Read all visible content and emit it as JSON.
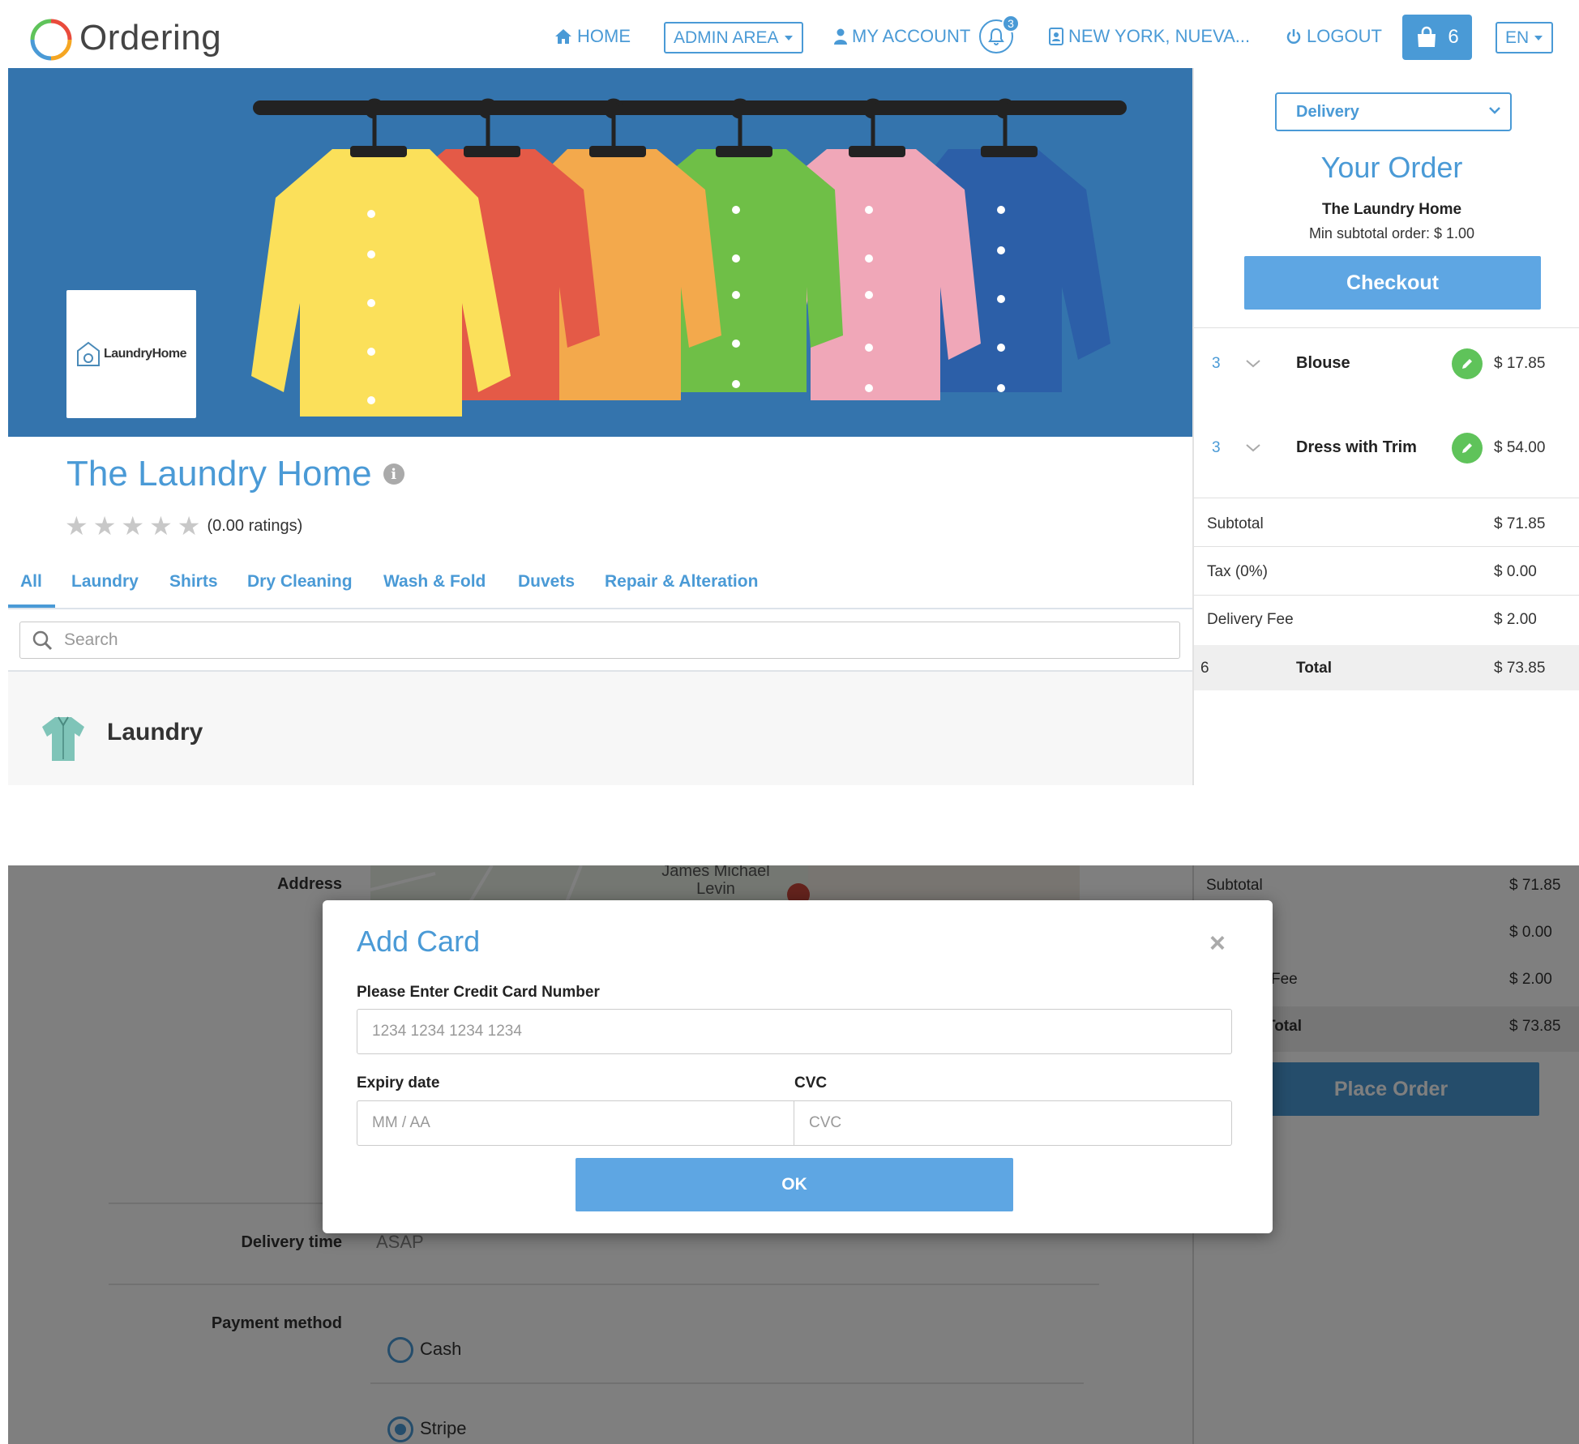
{
  "header": {
    "brand": "Ordering",
    "nav": {
      "home": "HOME",
      "admin": "ADMIN AREA",
      "account": "MY ACCOUNT",
      "notifications_count": "3",
      "location": "NEW YORK, NUEVA...",
      "logout": "LOGOUT",
      "cart_count": "6",
      "language": "EN"
    }
  },
  "store": {
    "logo_text": "LaundryHome",
    "name": "The Laundry Home",
    "ratings": "(0.00 ratings)",
    "stars": 0,
    "stars_total": 5
  },
  "tabs": [
    "All",
    "Laundry",
    "Shirts",
    "Dry Cleaning",
    "Wash & Fold",
    "Duvets",
    "Repair & Alteration"
  ],
  "active_tab": "All",
  "search": {
    "placeholder": "Search"
  },
  "category": {
    "title": "Laundry"
  },
  "order": {
    "mode": "Delivery",
    "title": "Your Order",
    "store_name": "The Laundry Home",
    "min_order": "Min subtotal order: $ 1.00",
    "checkout_label": "Checkout",
    "items": [
      {
        "qty": "3",
        "name": "Blouse",
        "price": "$ 17.85"
      },
      {
        "qty": "3",
        "name": "Dress with Trim",
        "price": "$ 54.00"
      }
    ],
    "summary": {
      "subtotal_label": "Subtotal",
      "subtotal": "$ 71.85",
      "tax_label": "Tax (0%)",
      "tax": "$ 0.00",
      "delivery_label": "Delivery Fee",
      "delivery": "$ 2.00",
      "count": "6",
      "total_label": "Total",
      "total": "$ 73.85"
    }
  },
  "checkout_page": {
    "address_label": "Address",
    "map_text": "James Michael Levin",
    "delivery_time_label": "Delivery time",
    "delivery_time": "ASAP",
    "payment_label": "Payment method",
    "payment_options": [
      "Cash",
      "Stripe"
    ],
    "selected_payment": "Stripe",
    "summary": {
      "subtotal_label": "Subtotal",
      "subtotal": "$ 71.85",
      "tax": "$ 0.00",
      "delivery_label_partial": "Fee",
      "delivery": "$ 2.00",
      "total_label_partial": "Total",
      "total": "$ 73.85"
    },
    "place_order_label": "Place Order"
  },
  "modal": {
    "title": "Add Card",
    "close_symbol": "×",
    "card_label": "Please Enter Credit Card Number",
    "card_placeholder": "1234 1234 1234 1234",
    "expiry_label": "Expiry date",
    "expiry_placeholder": "MM / AA",
    "cvc_label": "CVC",
    "cvc_placeholder": "CVC",
    "ok_label": "OK"
  },
  "colors": {
    "accent": "#4a9ad6",
    "button": "#5ea6e3",
    "hero_bg": "#3474ad",
    "edit_green": "#5fc35a"
  },
  "icons": [
    "ordering-logo-icon",
    "home-icon",
    "caret-down-icon",
    "user-icon",
    "bell-icon",
    "address-card-icon",
    "power-icon",
    "shopping-bag-icon",
    "info-icon",
    "star-icon",
    "search-icon",
    "shirt-icon",
    "chevron-down-icon",
    "pencil-icon",
    "close-icon"
  ]
}
